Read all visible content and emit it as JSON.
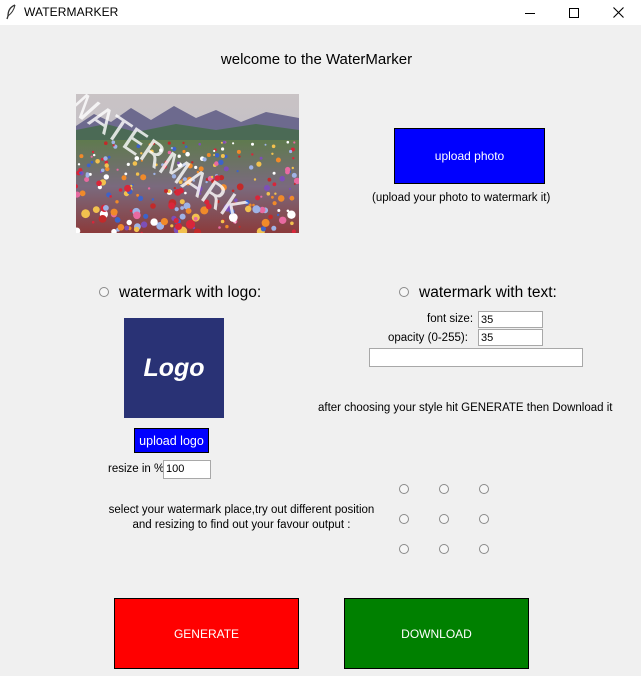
{
  "window": {
    "title": "WATERMARKER",
    "controls": [
      "minimize-icon",
      "maximize-icon",
      "close-icon"
    ]
  },
  "welcome": "welcome to the WaterMarker",
  "photo": {
    "overlay_text": "WATERMARK"
  },
  "upload_photo": {
    "label": "upload photo",
    "hint": "(upload your photo to watermark it)"
  },
  "logo_mode": {
    "radio_label": "watermark with logo:",
    "logo_text": "Logo",
    "upload_label": "upload logo",
    "resize_label": "resize in %",
    "resize_value": "100"
  },
  "text_mode": {
    "radio_label": "watermark with text:",
    "font_size_label": "font size:",
    "font_size_value": "35",
    "opacity_label": "opacity (0-255):",
    "opacity_value": "35",
    "text_value": ""
  },
  "generate_hint": "after choosing your style hit GENERATE then Download it",
  "placement": {
    "line1": "select your watermark place,try out different position",
    "line2": "and resizing to find out your favour output :",
    "options": [
      "top-left",
      "top-center",
      "top-right",
      "middle-left",
      "middle-center",
      "middle-right",
      "bottom-left",
      "bottom-center",
      "bottom-right"
    ]
  },
  "actions": {
    "generate": "GENERATE",
    "download": "DOWNLOAD"
  },
  "colors": {
    "upload_button": "#0000ff",
    "generate_button": "#ff0000",
    "download_button": "#008000",
    "logo_background": "#293275",
    "window_background": "#f0f0f0"
  }
}
